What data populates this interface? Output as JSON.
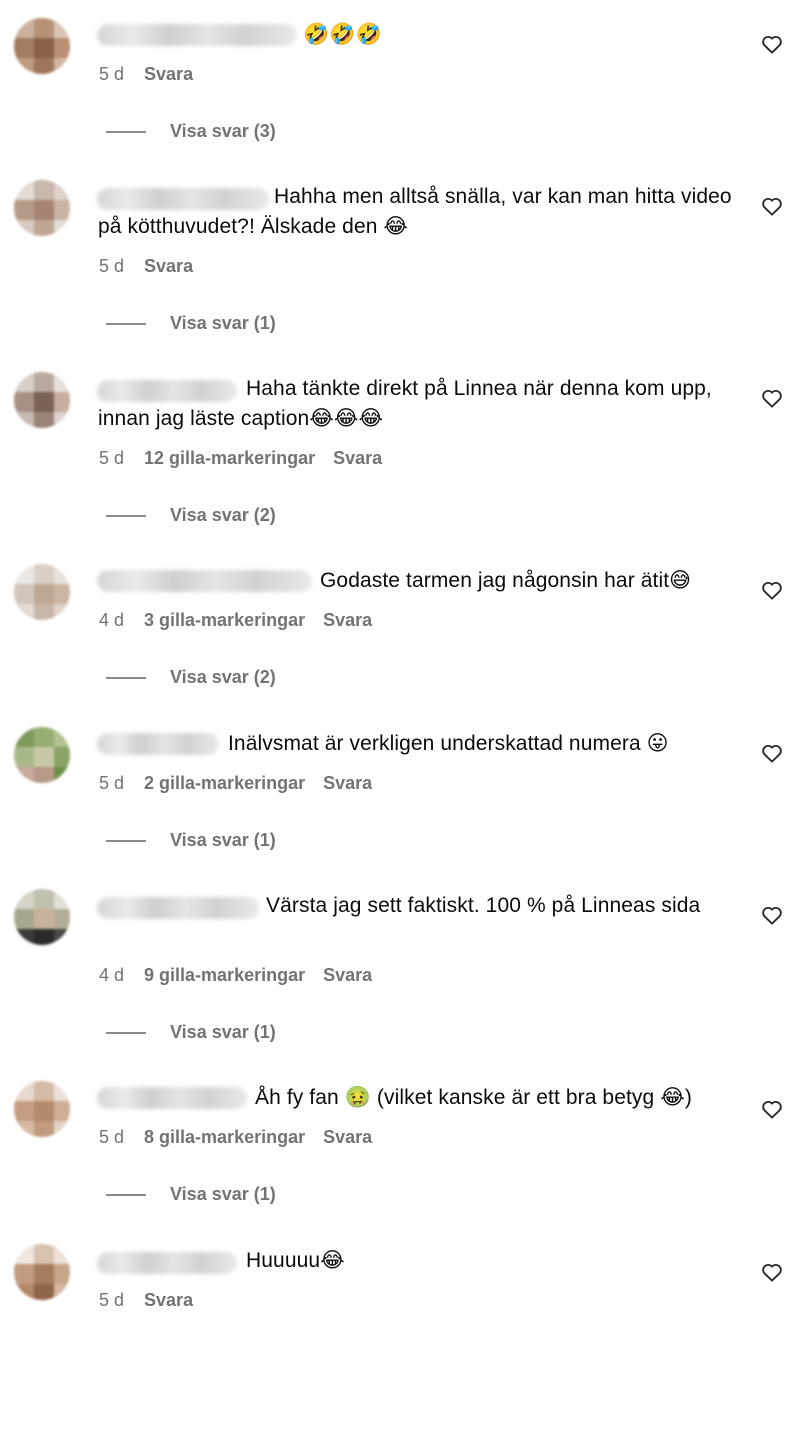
{
  "comments": [
    {
      "text": "🤣🤣🤣",
      "time": "5 d",
      "likes": "",
      "reply": "Svara",
      "view_replies": "Visa svar (3)"
    },
    {
      "text": "Hahha men alltså snälla, var kan man hitta video på kötthuvudet?! Älskade den 😂",
      "time": "5 d",
      "likes": "",
      "reply": "Svara",
      "view_replies": "Visa svar (1)"
    },
    {
      "text": "Haha tänkte direkt på Linnea när denna kom upp, innan jag läste caption😂😂😂",
      "time": "5 d",
      "likes": "12 gilla-markeringar",
      "reply": "Svara",
      "view_replies": "Visa svar (2)"
    },
    {
      "text": "Godaste tarmen jag någonsin har ätit😅",
      "time": "4 d",
      "likes": "3 gilla-markeringar",
      "reply": "Svara",
      "view_replies": "Visa svar (2)"
    },
    {
      "text": "Inälvsmat är verkligen underskattad numera 😛",
      "time": "5 d",
      "likes": "2 gilla-markeringar",
      "reply": "Svara",
      "view_replies": "Visa svar (1)"
    },
    {
      "text": "Värsta jag sett faktiskt. 100 % på Linneas sida",
      "time": "4 d",
      "likes": "9 gilla-markeringar",
      "reply": "Svara",
      "view_replies": "Visa svar (1)"
    },
    {
      "text": "Åh fy fan 🤢 (vilket kanske är ett bra betyg 😂)",
      "time": "5 d",
      "likes": "8 gilla-markeringar",
      "reply": "Svara",
      "view_replies": "Visa svar (1)"
    },
    {
      "text": "Huuuuu😂",
      "time": "5 d",
      "likes": "",
      "reply": "Svara",
      "view_replies": ""
    }
  ],
  "icons": {
    "like": "heart-outline-icon"
  },
  "colors": {
    "text": "#0b0b0b",
    "muted": "#737373",
    "background": "#ffffff"
  }
}
